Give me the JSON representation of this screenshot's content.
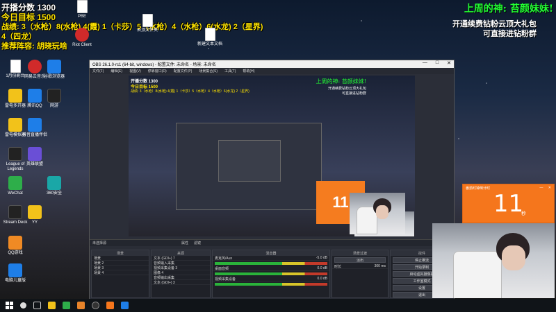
{
  "overlay": {
    "line1": "开播分数 1300",
    "line2": "今日目标 1500",
    "line3": "战绩: 3（水枪）8(水枪) 4(霞) 1（卡莎）5（水枪）4（水枪）6(水龙) 2（星界)",
    "line4": "4（四龙）",
    "line5": "推荐阵容: 胡晓玩啥"
  },
  "banner": {
    "title": "上周的神: 苔颜妹妹!",
    "promo1": "开通续费钻粉云顶大礼包",
    "promo2": "可直接进钻粉群"
  },
  "desktop_icons": [
    {
      "label": "1月份刷台",
      "kind": "doc"
    },
    {
      "label": "网易云音乐",
      "kind": "red"
    },
    {
      "label": "谷歌浏览器",
      "kind": "blue"
    },
    {
      "label": "雷电多开器",
      "kind": "yellow"
    },
    {
      "label": "腾讯QQ",
      "kind": "blue"
    },
    {
      "label": "网游",
      "kind": "dark"
    },
    {
      "label": "雷电模拟器",
      "kind": "yellow"
    },
    {
      "label": "League of Legends",
      "kind": "dark"
    },
    {
      "label": "WeChat",
      "kind": "green"
    },
    {
      "label": "Stream Deck",
      "kind": "dark"
    },
    {
      "label": "QQ游戏",
      "kind": "orange"
    },
    {
      "label": "电脑儿童版",
      "kind": "blue"
    },
    {
      "label": "PBE",
      "kind": "doc"
    },
    {
      "label": "Riot Client",
      "kind": "red"
    },
    {
      "label": "云顶文件夹",
      "kind": "doc"
    },
    {
      "label": "新建文本文档",
      "kind": "doc"
    },
    {
      "label": "抖音直播伴侣",
      "kind": "blue"
    },
    {
      "label": "YY",
      "kind": "yellow"
    },
    {
      "label": "英雄联盟",
      "kind": "purple"
    },
    {
      "label": "360安全",
      "kind": "teal"
    }
  ],
  "obs": {
    "title": "OBS 26.1.0-rc1 (64-bit, windows) - 配置文件: 未命名 - 场景: 未命名",
    "menu": [
      "文件(F)",
      "编辑(E)",
      "视图(V)",
      "停靠窗口(D)",
      "配置文件(P)",
      "场景集合(S)",
      "工具(T)",
      "帮助(H)"
    ],
    "win_controls": [
      "—",
      "□",
      "✕"
    ],
    "dock_tabs": [
      "未选择源",
      "属性",
      "滤镜"
    ],
    "panels": {
      "scenes": {
        "header": "场景",
        "items": [
          "场景",
          "场景 2",
          "场景 3",
          "场景 4"
        ]
      },
      "sources": {
        "header": "来源",
        "items": [
          "文本 (GDI+) 7",
          "音频输入采集",
          "视频采集设备 3",
          "图像 4",
          "音频输出采集",
          "文本 (GDI+) 3"
        ]
      },
      "mixer": {
        "header": "混音器",
        "items": [
          "麦克风/Aux",
          "桌面音频",
          "视频采集设备"
        ],
        "levels": [
          "-5.0 dB",
          "0.0 dB",
          "0.0 dB"
        ]
      },
      "transitions": {
        "header": "场景过渡",
        "fade": "淡出",
        "duration_label": "时长",
        "duration": "300 ms"
      },
      "controls": {
        "header": "控件",
        "buttons": [
          "停止推流",
          "开始录制",
          "启动虚拟摄像机",
          "工作室模式",
          "设置",
          "退出"
        ]
      }
    }
  },
  "timer": {
    "title": "番茄时钟倒计时",
    "value": "11",
    "unit": "秒",
    "controls": [
      "—",
      "✕"
    ]
  },
  "colors": {
    "accent_orange": "#f5761c",
    "banner_green": "#22ff33",
    "overlay_yellow": "#ffe400"
  }
}
